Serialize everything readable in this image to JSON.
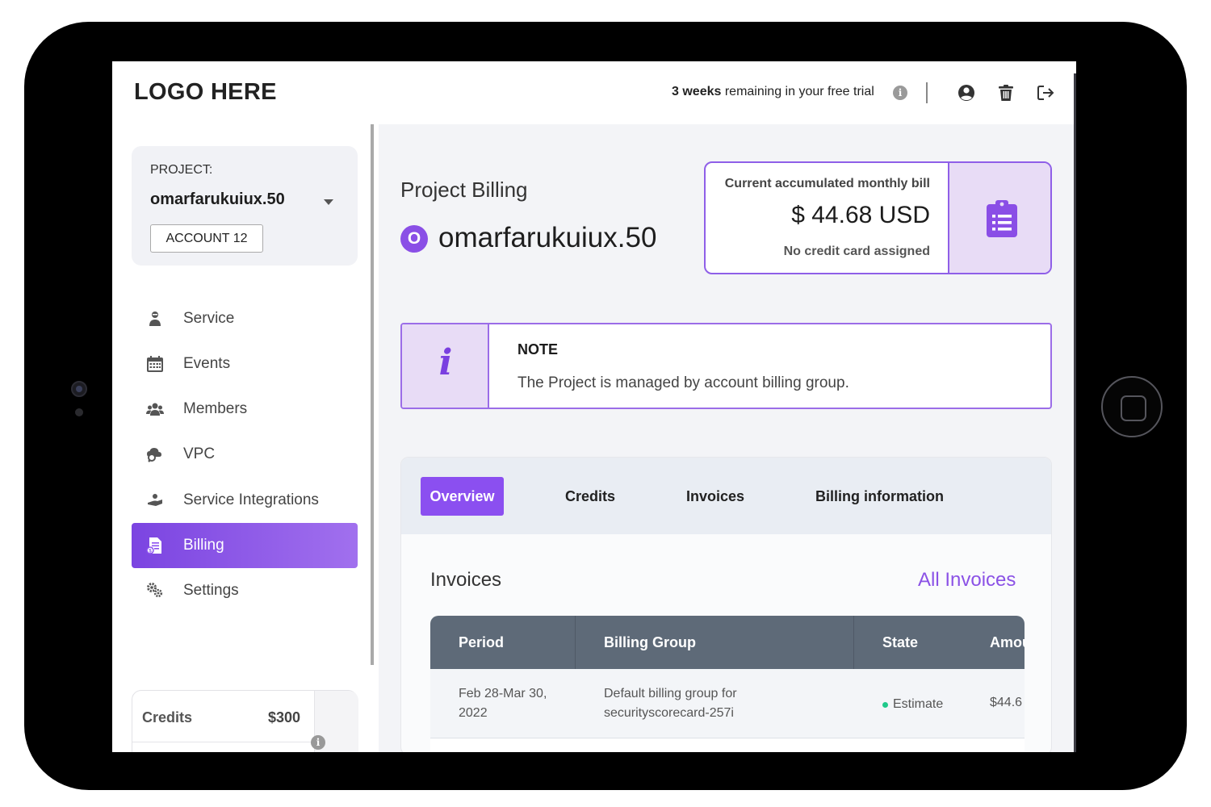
{
  "header": {
    "logo": "LOGO HERE",
    "trial_bold": "3 weeks",
    "trial_rest": " remaining in your free trial",
    "info_glyph": "i",
    "icons": [
      "user-circle-icon",
      "trash-icon",
      "logout-icon"
    ]
  },
  "project": {
    "label": "PROJECT:",
    "name": "omarfarukuiux.50",
    "account_button": "ACCOUNT 12"
  },
  "sidebar": {
    "items": [
      {
        "label": "Service",
        "icon": "service-icon"
      },
      {
        "label": "Events",
        "icon": "calendar-icon"
      },
      {
        "label": "Members",
        "icon": "members-icon"
      },
      {
        "label": "VPC",
        "icon": "vpc-icon"
      },
      {
        "label": "Service Integrations",
        "icon": "integrations-icon"
      },
      {
        "label": "Billing",
        "icon": "billing-icon",
        "active": true
      },
      {
        "label": "Settings",
        "icon": "settings-icon"
      }
    ],
    "credits": {
      "label": "Credits",
      "value": "$300",
      "info_glyph": "i"
    }
  },
  "main": {
    "page_title": "Project Billing",
    "project_badge": "O",
    "project_name": "omarfarukuiux.50",
    "bill": {
      "label": "Current accumulated monthly bill",
      "amount": "$ 44.68 USD",
      "note": "No credit card assigned"
    },
    "note": {
      "glyph": "i",
      "title": "NOTE",
      "text": "The Project is managed by account billing group."
    },
    "tabs": [
      {
        "label": "Overview",
        "active": true
      },
      {
        "label": "Credits"
      },
      {
        "label": "Invoices"
      },
      {
        "label": "Billing information"
      }
    ],
    "invoices": {
      "title": "Invoices",
      "all_link": "All Invoices",
      "columns": [
        "Period",
        "Billing Group",
        "State",
        "Amou"
      ],
      "rows": [
        {
          "period_line1": "Feb 28-Mar 30,",
          "period_line2": "2022",
          "group_line1": "Default billing group for",
          "group_line2": "securityscorecard-257i",
          "state": "Estimate",
          "amount": "$44.6"
        }
      ]
    }
  },
  "colors": {
    "accent": "#8b4ff0",
    "accent_light": "#e8dcf6",
    "table_header": "#5e6a78",
    "state_estimate": "#1fc98a"
  }
}
